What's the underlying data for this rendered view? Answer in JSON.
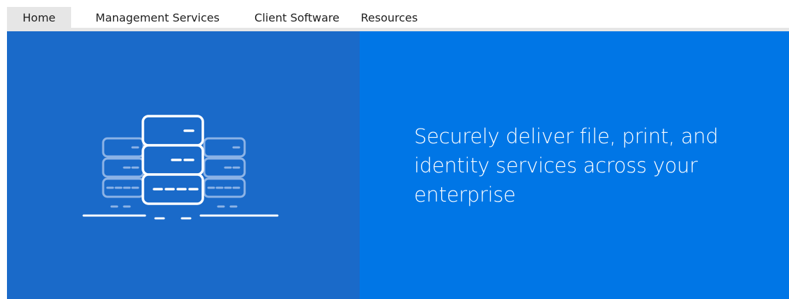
{
  "nav": {
    "tabs": [
      {
        "label": "Home",
        "active": true
      },
      {
        "label": "Management Services",
        "active": false
      },
      {
        "label": "Client Software",
        "active": false
      },
      {
        "label": "Resources",
        "active": false
      }
    ]
  },
  "hero": {
    "headline": "Securely deliver file, print, and identity services across your enterprise",
    "illustration_icon": "server-rack-icon"
  },
  "colors": {
    "tab_active_bg": "#e6e6e6",
    "hero_left_bg": "#1a6ac9",
    "hero_right_bg": "#0076e6",
    "text_light": "#ffffff"
  }
}
